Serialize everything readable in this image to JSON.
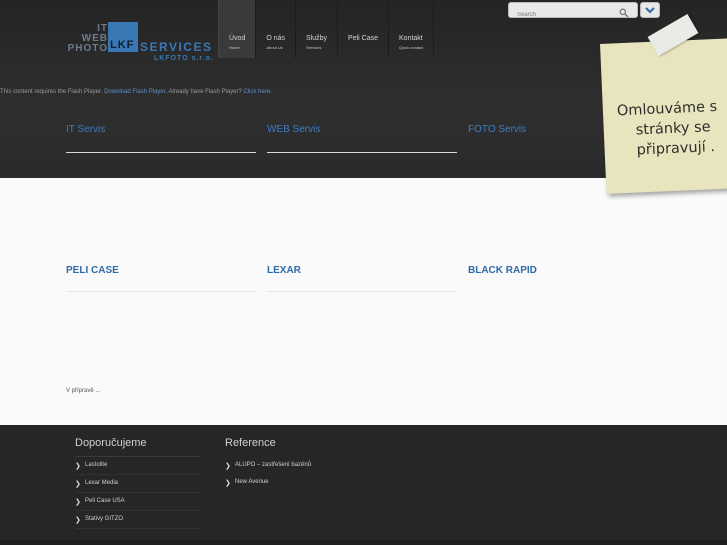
{
  "logo": {
    "it": "IT",
    "web": "WEB",
    "photo": "PHOTO",
    "lkf": "LKF",
    "services": "SERVICES",
    "company": "LKFOTO s.r.o."
  },
  "nav": [
    {
      "label": "Úvod",
      "sub": "Home"
    },
    {
      "label": "O nás",
      "sub": "About Us"
    },
    {
      "label": "Služby",
      "sub": "Services"
    },
    {
      "label": "Peli Case",
      "sub": ""
    },
    {
      "label": "Kontakt",
      "sub": "Quick contact"
    }
  ],
  "search": {
    "placeholder": "Search"
  },
  "flash": {
    "text": "This content requires the Flash Player.",
    "download_link": "Download Flash Player",
    "already_text": ". Already have Flash Player?",
    "click_link": "Click here."
  },
  "services": [
    "IT Servis",
    "WEB Servis",
    "FOTO Servis"
  ],
  "note": {
    "line1": "Omlouváme s",
    "line2": "stránky se",
    "line3": "připravují ."
  },
  "categories": [
    "PELI CASE",
    "LEXAR",
    "BLACK RAPID"
  ],
  "content": {
    "status": "V přípravě ..."
  },
  "footer": {
    "recommend": {
      "title": "Doporučujeme",
      "items": [
        "Lastolite",
        "Lexar Media",
        "Peli Case USA",
        "Stativy GITZO"
      ]
    },
    "reference": {
      "title": "Reference",
      "items": [
        "ALUPO – zastřešení bazénů",
        "New Avenue"
      ]
    }
  },
  "colors": {
    "accent": "#3a78b5",
    "dark_bg": "#2b2b2b",
    "note": "#e8e4bd"
  }
}
